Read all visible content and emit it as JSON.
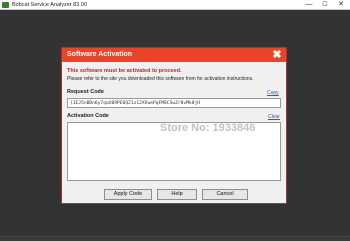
{
  "window": {
    "title": "Bobcat Service Analyzer 83.00",
    "minimize_glyph": "—",
    "maximize_glyph": "☐",
    "close_glyph": "✕"
  },
  "dialog": {
    "title": "Software Activation",
    "close_glyph": "✖",
    "warning": "This software must be activated to proceed.",
    "info": "Please refer to the site you downloaded this software from for activation instructions.",
    "request_code_label": "Request Code",
    "copy_link": "Copy",
    "request_code_value": "{1EJ5nBDn6y7qaX09PE0Q21z12XVwePqFM8CSwZr8vMk8jH",
    "activation_code_label": "Activation Code",
    "clear_link": "Clear",
    "activation_code_value": "",
    "buttons": {
      "apply": "Apply Code",
      "help": "Help",
      "cancel": "Cancel"
    }
  },
  "watermark": "Store No: 1933846",
  "colors": {
    "header": "#e8442a",
    "warning": "#d0201a",
    "link": "#1d5fc4",
    "background": "#333333"
  }
}
